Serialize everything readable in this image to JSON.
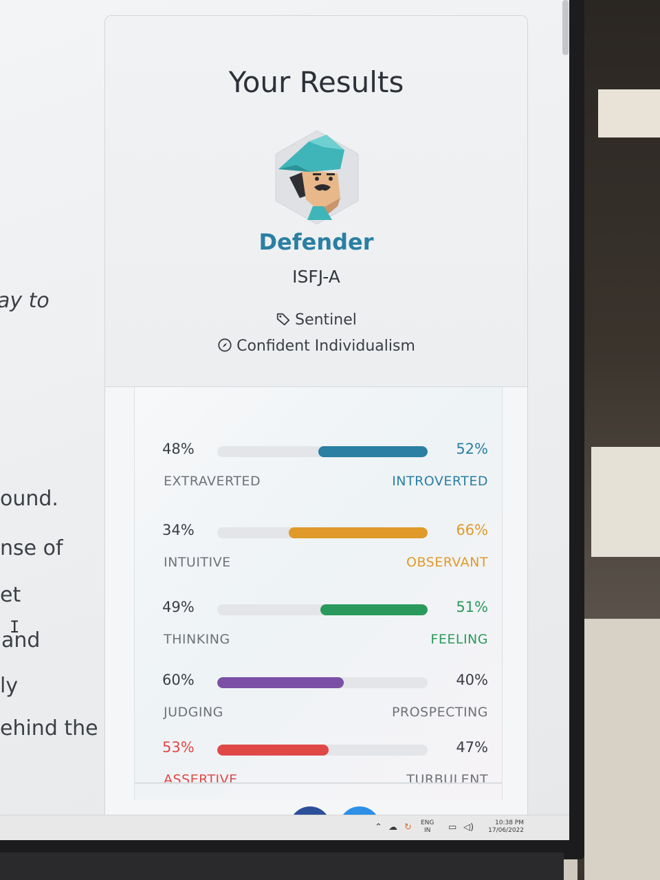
{
  "page": {
    "title": "Your Results"
  },
  "article": {
    "lines": [
      "ay to",
      "ound.",
      "nse of",
      "et",
      "and",
      "ly",
      "ehind the"
    ]
  },
  "result": {
    "name": "Defender",
    "code": "ISFJ-A",
    "role": "Sentinel",
    "strategy": "Confident Individualism",
    "accent_color": "#2a7fa3"
  },
  "traits": [
    {
      "left_label": "EXTRAVERTED",
      "left_pct": "48%",
      "right_label": "INTROVERTED",
      "right_pct": "52%",
      "value": 52,
      "side": "right",
      "color": "#2a7fa3"
    },
    {
      "left_label": "INTUITIVE",
      "left_pct": "34%",
      "right_label": "OBSERVANT",
      "right_pct": "66%",
      "value": 66,
      "side": "right",
      "color": "#e09a2a"
    },
    {
      "left_label": "THINKING",
      "left_pct": "49%",
      "right_label": "FEELING",
      "right_pct": "51%",
      "value": 51,
      "side": "right",
      "color": "#2a9a5c"
    },
    {
      "left_label": "JUDGING",
      "left_pct": "60%",
      "right_label": "PROSPECTING",
      "right_pct": "40%",
      "value": 60,
      "side": "left",
      "color": "#7b4fa6"
    },
    {
      "left_label": "ASSERTIVE",
      "left_pct": "53%",
      "right_label": "TURBULENT",
      "right_pct": "47%",
      "value": 53,
      "side": "left",
      "color": "#e04848"
    }
  ],
  "taskbar": {
    "lang_top": "ENG",
    "lang_bottom": "IN",
    "time": "10:38 PM",
    "date": "17/06/2022"
  }
}
